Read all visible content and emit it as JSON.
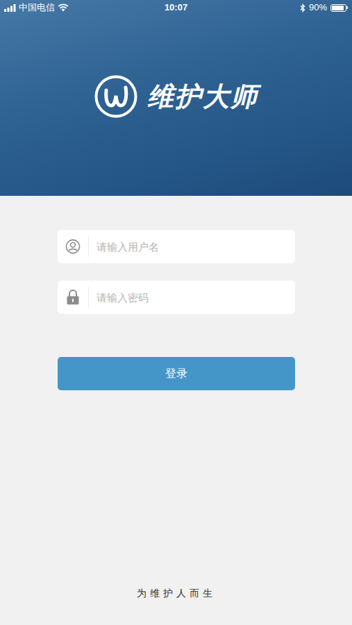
{
  "status_bar": {
    "carrier": "中国电信",
    "time": "10:07",
    "battery_text": "90%",
    "battery_level": 0.9
  },
  "logo": {
    "title": "维护大师"
  },
  "form": {
    "username": {
      "placeholder": "请输入用户名"
    },
    "password": {
      "placeholder": "请输入密码"
    }
  },
  "login_button": "登录",
  "slogan": "为维护人而生"
}
